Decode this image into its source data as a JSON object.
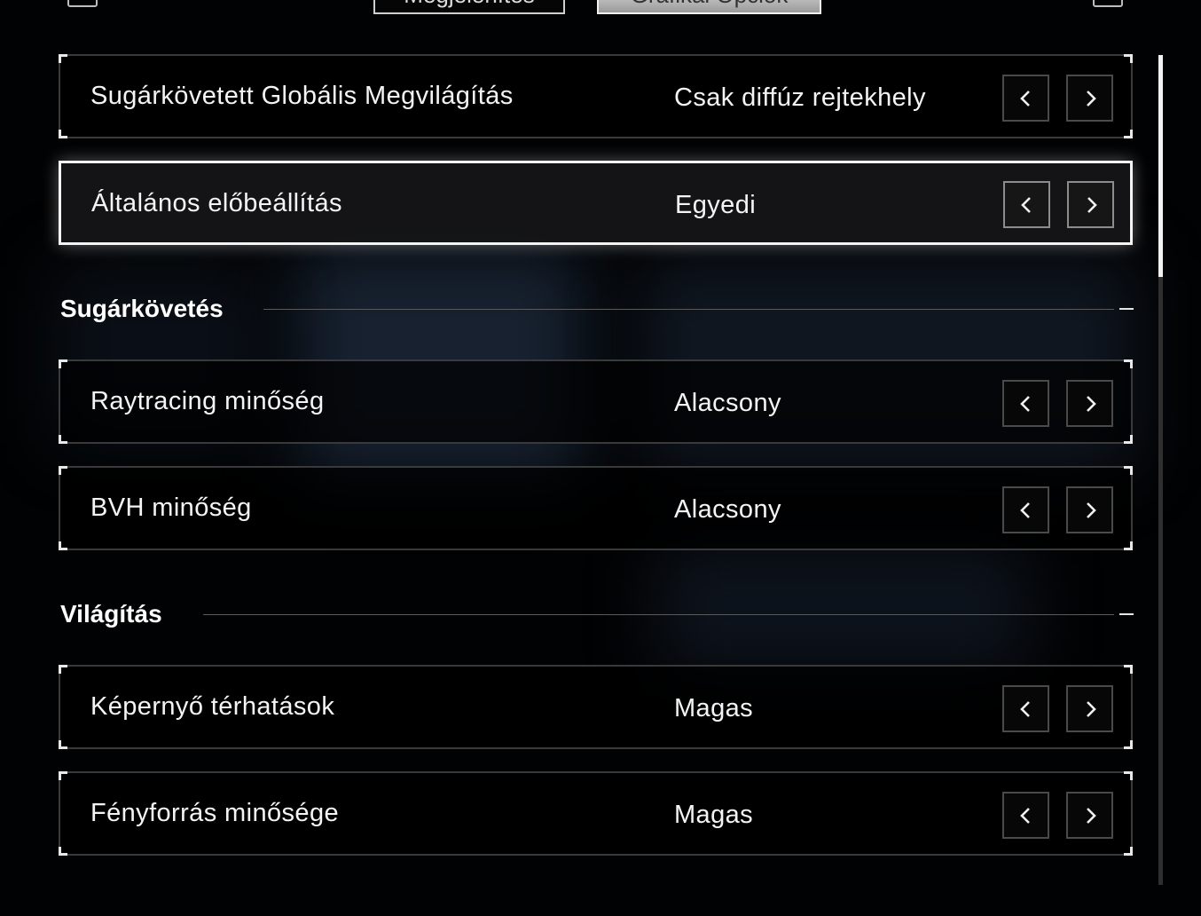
{
  "top_tabs": {
    "left_label": "Megjelenítés",
    "right_label": "Grafikai Opciók"
  },
  "rows_top": [
    {
      "label": "Sugárkövetett Globális Megvilágítás",
      "value": "Csak diffúz rejtekhely"
    },
    {
      "label": "Általános előbeállítás",
      "value": "Egyedi"
    }
  ],
  "sections": [
    {
      "title": "Sugárkövetés",
      "rows": [
        {
          "label": "Raytracing minőség",
          "value": "Alacsony"
        },
        {
          "label": "BVH minőség",
          "value": "Alacsony"
        }
      ]
    },
    {
      "title": "Világítás",
      "rows": [
        {
          "label": "Képernyő térhatások",
          "value": "Magas"
        },
        {
          "label": "Fényforrás minősége",
          "value": "Magas"
        }
      ]
    }
  ],
  "icons": {
    "prev": "chevron-left-icon",
    "next": "chevron-right-icon"
  },
  "colors": {
    "background": "#000000",
    "text": "#f4f4f4",
    "row_border": "#3a3a3a",
    "selected_border": "#f4f4f4",
    "active_tab": "#d9d9d9"
  }
}
